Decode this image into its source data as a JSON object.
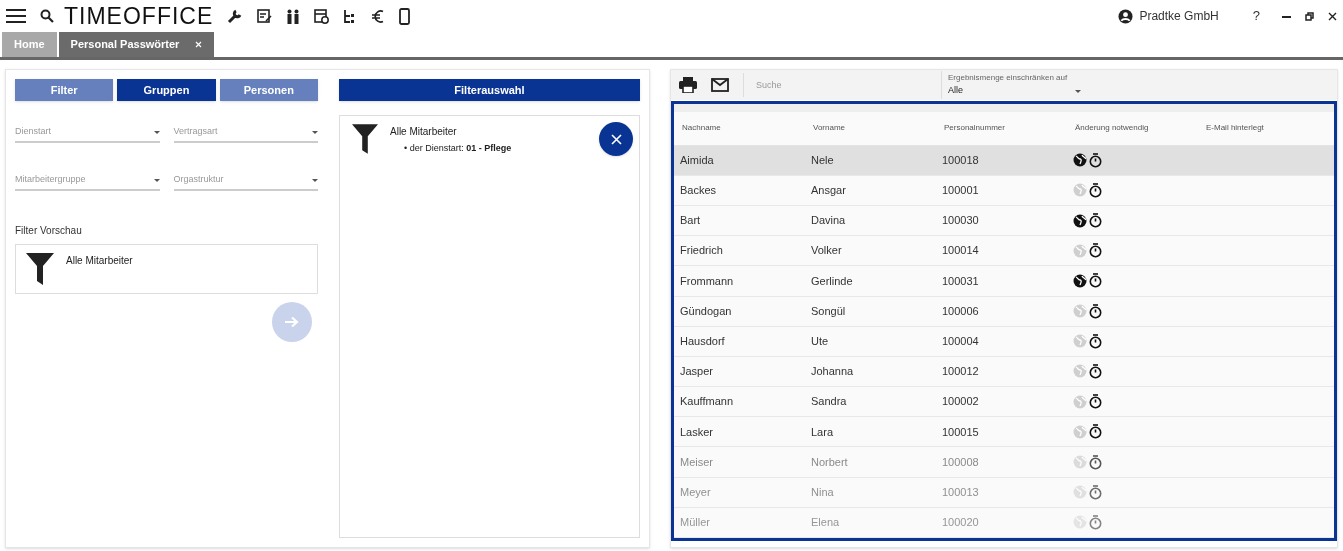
{
  "app": {
    "logo": "TIMEOFFICE",
    "user": "Pradtke GmbH",
    "help": "?"
  },
  "tabs": [
    {
      "label": "Home",
      "selected": false,
      "closable": false
    },
    {
      "label": "Personal Passwörter",
      "selected": true,
      "closable": true
    }
  ],
  "filter_panel": {
    "modes": [
      {
        "label": "Filter",
        "selected": false
      },
      {
        "label": "Gruppen",
        "selected": true
      },
      {
        "label": "Personen",
        "selected": false
      }
    ],
    "dropdowns": [
      {
        "placeholder": "Dienstart"
      },
      {
        "placeholder": "Vertragsart"
      },
      {
        "placeholder": "Mitarbeitergruppe"
      },
      {
        "placeholder": "Orgastruktur"
      }
    ],
    "preview_label": "Filter Vorschau",
    "preview_text": "Alle Mitarbeiter"
  },
  "selection_panel": {
    "title": "Filterauswahl",
    "heading": "Alle Mitarbeiter",
    "criteria": [
      "• der Dienstart: **01 - Pflege**"
    ]
  },
  "toolbar": {
    "search_placeholder": "Suche",
    "restrict_label": "Ergebnismenge einschränken auf",
    "restrict_value": "Alle"
  },
  "table": {
    "columns": [
      "Nachname",
      "Vorname",
      "Personalnummer",
      "Änderung notwendig",
      "E-Mail hinterlegt"
    ],
    "rows": [
      {
        "last": "Aimida",
        "first": "Nele",
        "number": "100018",
        "web": true,
        "selected": true
      },
      {
        "last": "Backes",
        "first": "Ansgar",
        "number": "100001",
        "web": false,
        "selected": false
      },
      {
        "last": "Bart",
        "first": "Davina",
        "number": "100030",
        "web": true,
        "selected": false
      },
      {
        "last": "Friedrich",
        "first": "Volker",
        "number": "100014",
        "web": false,
        "selected": false
      },
      {
        "last": "Frommann",
        "first": "Gerlinde",
        "number": "100031",
        "web": true,
        "selected": false
      },
      {
        "last": "Gündogan",
        "first": "Songül",
        "number": "100006",
        "web": false,
        "selected": false
      },
      {
        "last": "Hausdorf",
        "first": "Ute",
        "number": "100004",
        "web": false,
        "selected": false
      },
      {
        "last": "Jasper",
        "first": "Johanna",
        "number": "100012",
        "web": false,
        "selected": false
      },
      {
        "last": "Kauffmann",
        "first": "Sandra",
        "number": "100002",
        "web": false,
        "selected": false
      },
      {
        "last": "Lasker",
        "first": "Lara",
        "number": "100015",
        "web": false,
        "selected": false
      },
      {
        "last": "Meiser",
        "first": "Norbert",
        "number": "100008",
        "web": false,
        "selected": false
      },
      {
        "last": "Meyer",
        "first": "Nina",
        "number": "100013",
        "web": false,
        "selected": false
      },
      {
        "last": "Müller",
        "first": "Elena",
        "number": "100020",
        "web": false,
        "selected": false
      }
    ]
  }
}
